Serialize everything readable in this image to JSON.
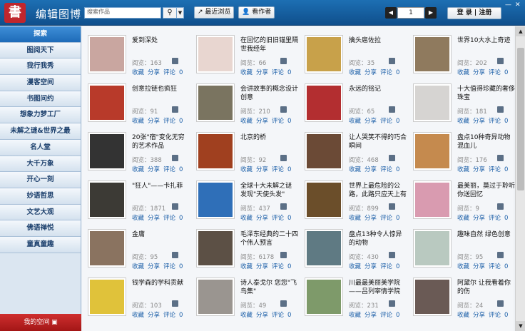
{
  "header": {
    "logo_char": "書",
    "app_title": "编辑图博",
    "search_placeholder": "搜索作品",
    "search_icon": "search-icon",
    "recent_label": "↗ 最近浏览",
    "author_label": "👤 看作者",
    "page_number": "1",
    "login_label": "登 录 | 注册",
    "win_min": "—",
    "win_close": "✕"
  },
  "sidebar": {
    "items": [
      {
        "label": "探索",
        "active": true
      },
      {
        "label": "图阅天下"
      },
      {
        "label": "我行我秀"
      },
      {
        "label": "漫客空间"
      },
      {
        "label": "书图问约"
      },
      {
        "label": "想象力梦工厂"
      },
      {
        "label": "未解之谜&世界之最"
      },
      {
        "label": "名人堂"
      },
      {
        "label": "大千万象"
      },
      {
        "label": "开心一刻"
      },
      {
        "label": "妙语哲思"
      },
      {
        "label": "文艺大观"
      },
      {
        "label": "佛语禅悦"
      },
      {
        "label": "童真童趣"
      }
    ],
    "my_space": "我的空间 ▣"
  },
  "action_labels": {
    "fav": "收藏",
    "share": "分享",
    "comment": "评论"
  },
  "cards": [
    {
      "title": "爱到深处",
      "views": "阅览：163",
      "comments": "0",
      "color": "#c9a6a0"
    },
    {
      "title": "在回忆的旧旧锚里隔世我经年",
      "views": "阅览：66",
      "comments": "0",
      "color": "#e8d6d0"
    },
    {
      "title": "擒头扈佐拉",
      "views": "阅览：35",
      "comments": "0",
      "color": "#c8a14a"
    },
    {
      "title": "世界10大水上奇迹",
      "views": "阅览：202",
      "comments": "0",
      "color": "#8f7a5e"
    },
    {
      "title": "创意拉链也疯狂",
      "views": "阅览：91",
      "comments": "0",
      "color": "#b83a2a"
    },
    {
      "title": "会讲故事的概念设计创意",
      "views": "阅览：210",
      "comments": "0",
      "color": "#7a7460"
    },
    {
      "title": "永远的铭记",
      "views": "阅览：65",
      "comments": "0",
      "color": "#b32e30"
    },
    {
      "title": "十大值得珍藏的奢侈珠宝",
      "views": "阅览：181",
      "comments": "0",
      "color": "#d6d4d2"
    },
    {
      "title": "20张\"宿\"变化无穷的艺术作品",
      "views": "阅览：388",
      "comments": "0",
      "color": "#333333"
    },
    {
      "title": "北京的桥",
      "views": "阅览：92",
      "comments": "0",
      "color": "#a0401f"
    },
    {
      "title": "让人哭笑不得的巧合瞬间",
      "views": "阅览：468",
      "comments": "0",
      "color": "#6b4a36"
    },
    {
      "title": "盘点10种奇异动物混血儿",
      "views": "阅览：176",
      "comments": "0",
      "color": "#c58a4e"
    },
    {
      "title": "\"狂人\"——卡扎菲",
      "views": "阅览：1871",
      "comments": "0",
      "color": "#3c3a35"
    },
    {
      "title": "全球十大未解之谜 发现\"天使头发\"",
      "views": "阅览：437",
      "comments": "0",
      "color": "#2f6fb8"
    },
    {
      "title": "世界上最危险的公路，此路只应天上有",
      "views": "阅览：899",
      "comments": "0",
      "color": "#6b4e2a"
    },
    {
      "title": "最美丽，莫过于聆听你送回忆",
      "views": "阅览：9",
      "comments": "0",
      "color": "#d99bb0"
    },
    {
      "title": "金庸",
      "views": "阅览：95",
      "comments": "0",
      "color": "#8a7360"
    },
    {
      "title": "毛泽东经典的二十四个伟人预言",
      "views": "阅览：6178",
      "comments": "0",
      "color": "#5c5045"
    },
    {
      "title": "盘点13种令人惊异的动物",
      "views": "阅览：430",
      "comments": "0",
      "color": "#5f7a83"
    },
    {
      "title": "趣味自然 绿色创意",
      "views": "阅览：95",
      "comments": "0",
      "color": "#b9c9c0"
    },
    {
      "title": "钱学森的学科贡献",
      "views": "阅览：103",
      "comments": "0",
      "color": "#e0c23a"
    },
    {
      "title": "诗人泰戈尔 您您\"飞鸟集\"",
      "views": "阅览：49",
      "comments": "0",
      "color": "#9a9590"
    },
    {
      "title": "川最最美丽美学院——吕列宰情学院",
      "views": "阅览：231",
      "comments": "0",
      "color": "#7e9a6a"
    },
    {
      "title": "阿黛尔 让我看着你的伤",
      "views": "阅览：24",
      "comments": "0",
      "color": "#6a5a55"
    }
  ],
  "scrollbar": {
    "up": "▲",
    "down": "▼"
  }
}
